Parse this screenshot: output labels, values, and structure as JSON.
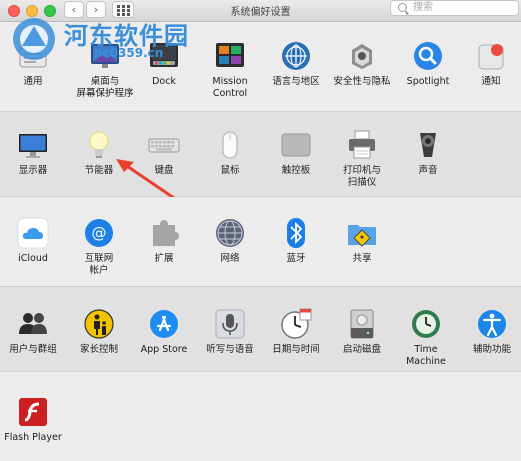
{
  "window": {
    "title": "系统偏好设置",
    "search_placeholder": "搜索"
  },
  "watermark": {
    "title": "河东软件园",
    "url": "pc0359.cn"
  },
  "section1": [
    {
      "label": "通用",
      "icon": "general-icon"
    },
    {
      "label": "桌面与\n屏幕保护程序",
      "icon": "desktop-screensaver-icon"
    },
    {
      "label": "Dock",
      "icon": "dock-icon"
    },
    {
      "label": "Mission\nControl",
      "icon": "mission-control-icon"
    },
    {
      "label": "语言与地区",
      "icon": "language-region-icon"
    },
    {
      "label": "安全性与隐私",
      "icon": "security-privacy-icon"
    },
    {
      "label": "Spotlight",
      "icon": "spotlight-icon"
    },
    {
      "label": "通知",
      "icon": "notifications-icon"
    }
  ],
  "section2": [
    {
      "label": "显示器",
      "icon": "displays-icon"
    },
    {
      "label": "节能器",
      "icon": "energy-saver-icon"
    },
    {
      "label": "键盘",
      "icon": "keyboard-icon"
    },
    {
      "label": "鼠标",
      "icon": "mouse-icon"
    },
    {
      "label": "触控板",
      "icon": "trackpad-icon"
    },
    {
      "label": "打印机与\n扫描仪",
      "icon": "printers-scanners-icon"
    },
    {
      "label": "声音",
      "icon": "sound-icon"
    }
  ],
  "section3": [
    {
      "label": "iCloud",
      "icon": "icloud-icon"
    },
    {
      "label": "互联网\n帐户",
      "icon": "internet-accounts-icon"
    },
    {
      "label": "扩展",
      "icon": "extensions-icon"
    },
    {
      "label": "网络",
      "icon": "network-icon"
    },
    {
      "label": "蓝牙",
      "icon": "bluetooth-icon"
    },
    {
      "label": "共享",
      "icon": "sharing-icon"
    }
  ],
  "section4": [
    {
      "label": "用户与群组",
      "icon": "users-groups-icon"
    },
    {
      "label": "家长控制",
      "icon": "parental-controls-icon"
    },
    {
      "label": "App Store",
      "icon": "app-store-icon"
    },
    {
      "label": "听写与语音",
      "icon": "dictation-speech-icon"
    },
    {
      "label": "日期与时间",
      "icon": "date-time-icon"
    },
    {
      "label": "启动磁盘",
      "icon": "startup-disk-icon"
    },
    {
      "label": "Time Machine",
      "icon": "time-machine-icon"
    },
    {
      "label": "辅助功能",
      "icon": "accessibility-icon"
    }
  ],
  "section5": [
    {
      "label": "Flash Player",
      "icon": "flash-player-icon"
    }
  ],
  "colors": {
    "accent": "#1a82f7",
    "arrow": "#e8402a"
  }
}
